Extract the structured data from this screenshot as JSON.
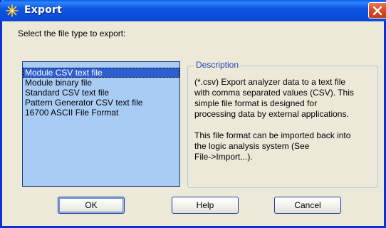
{
  "window": {
    "title": "Export"
  },
  "prompt": "Select the file type to export:",
  "file_types": [
    {
      "label": "Module CSV text file",
      "selected": true
    },
    {
      "label": "Module binary file",
      "selected": false
    },
    {
      "label": "Standard CSV text file",
      "selected": false
    },
    {
      "label": "Pattern Generator CSV text file",
      "selected": false
    },
    {
      "label": "16700 ASCII File Format",
      "selected": false
    }
  ],
  "description": {
    "legend": "Description",
    "paragraph1_line1": " (*.csv) Export analyzer data to a text file",
    "paragraph1_line2": "with comma separated values (CSV).  This",
    "paragraph1_line3": "simple file format is designed for",
    "paragraph1_line4": "processing data by external applications.",
    "paragraph2_line1": "This file format can be imported back into",
    "paragraph2_line2": "the logic analysis system (See",
    "paragraph2_line3": "File->Import...)."
  },
  "buttons": {
    "ok": "OK",
    "help": "Help",
    "cancel": "Cancel"
  },
  "icons": {
    "title": "sparkle-icon",
    "close": "close-icon"
  },
  "colors": {
    "titlebar": "#0A5FEF",
    "list_bg": "#A9CCF5",
    "selection": "#2E5FD0",
    "dialog_bg": "#ECE9D8",
    "legend": "#1F45B4",
    "close_button": "#D64B23"
  }
}
